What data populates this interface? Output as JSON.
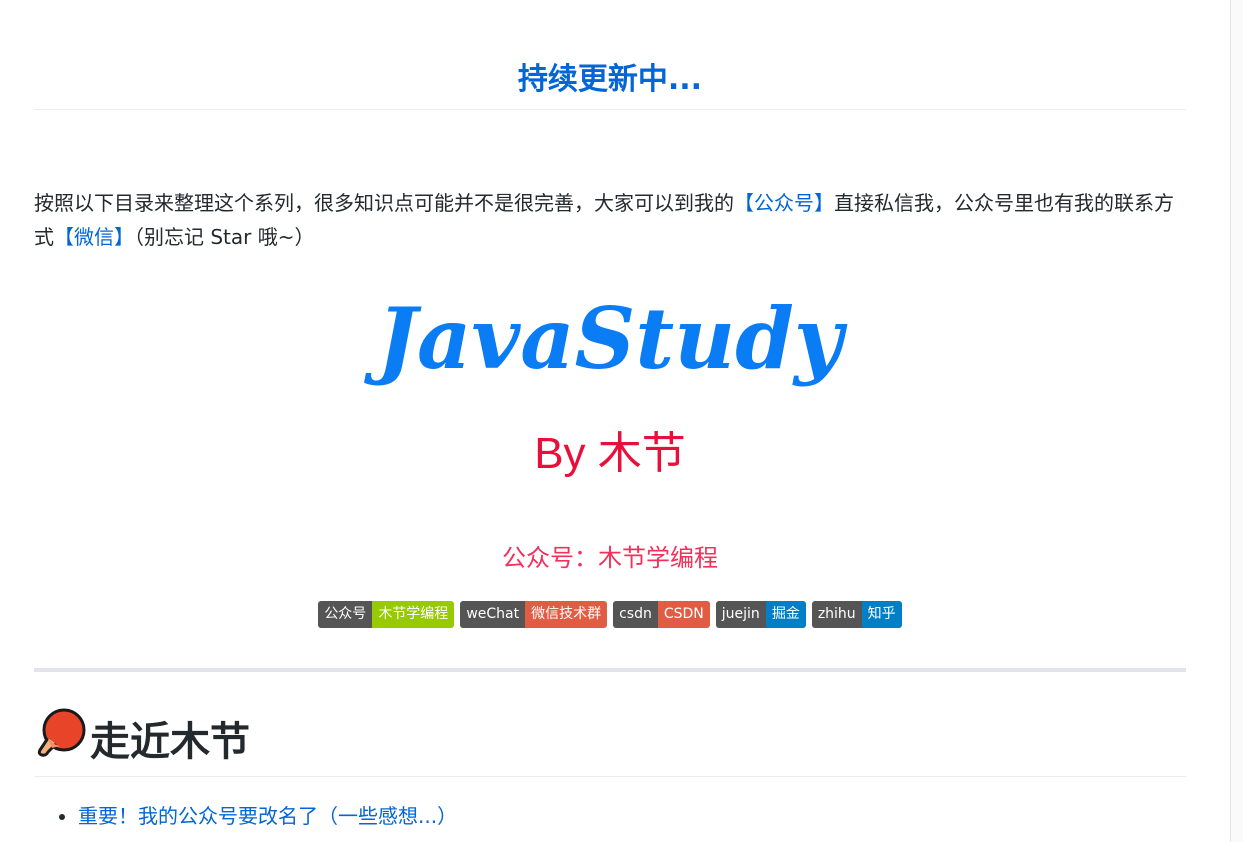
{
  "title": "持续更新中...",
  "intro": {
    "text1": "按照以下目录来整理这个系列，很多知识点可能并不是很完善，大家可以到我的",
    "link1": "【公众号】",
    "text2": "直接私信我，公众号里也有我的联系方式",
    "link2": "【微信】",
    "text3": "（别忘记 Star 哦~）"
  },
  "logo": {
    "main": "JavaStudy",
    "byline": "By 木节",
    "account": "公众号：木节学编程",
    "colors": {
      "main": "#0a7cf4",
      "byline": "#e8103a",
      "account": "#f2305a"
    }
  },
  "badges": [
    {
      "label": "公众号",
      "value": "木节学编程",
      "color": "#97ca00"
    },
    {
      "label": "weChat",
      "value": "微信技术群",
      "color": "#e05d44"
    },
    {
      "label": "csdn",
      "value": "CSDN",
      "color": "#e05d44"
    },
    {
      "label": "juejin",
      "value": "掘金",
      "color": "#007ec6"
    },
    {
      "label": "zhihu",
      "value": "知乎",
      "color": "#007ec6"
    }
  ],
  "section": {
    "heading": "走近木节",
    "icon": "ping-pong-paddle-icon",
    "items": [
      {
        "text": "重要！我的公众号要改名了（一些感想...）"
      }
    ]
  }
}
